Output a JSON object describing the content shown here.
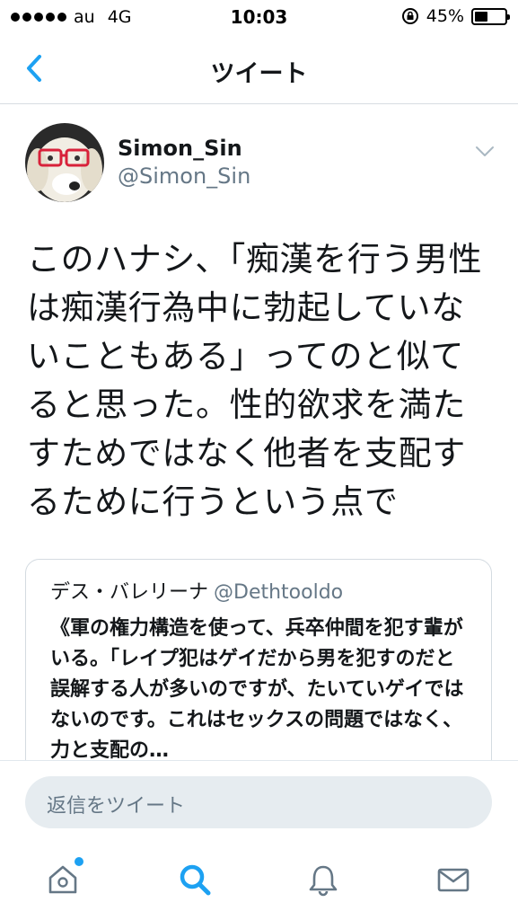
{
  "status_bar": {
    "carrier": "au",
    "network": "4G",
    "time": "10:03",
    "battery": "45%",
    "battery_level": 0.45
  },
  "nav": {
    "title": "ツイート",
    "back_icon": "chevron-left-icon"
  },
  "tweet": {
    "name": "Simon_Sin",
    "handle": "@Simon_Sin",
    "text": "このハナシ、「痴漢を行う男性は痴漢行為中に勃起していないこともある」ってのと似てると思った。性的欲求を満たすためではなく他者を支配するために行うという点で"
  },
  "quote": {
    "name": "デス・バレリーナ",
    "handle": "@Dethtooldo",
    "text": "《軍の権力構造を使って、兵卒仲間を犯す輩がいる。「レイプ犯はゲイだから男を犯すのだと誤解する人が多いのですが、たいていゲイではないのです。これはセックスの問題ではなく、力と支配の…"
  },
  "reply": {
    "placeholder": "返信をツイート"
  },
  "tabs": {
    "accent": "#1da1f2",
    "icon_gray": "#657786",
    "items": [
      "home-icon",
      "search-icon",
      "bell-icon",
      "mail-icon"
    ]
  }
}
